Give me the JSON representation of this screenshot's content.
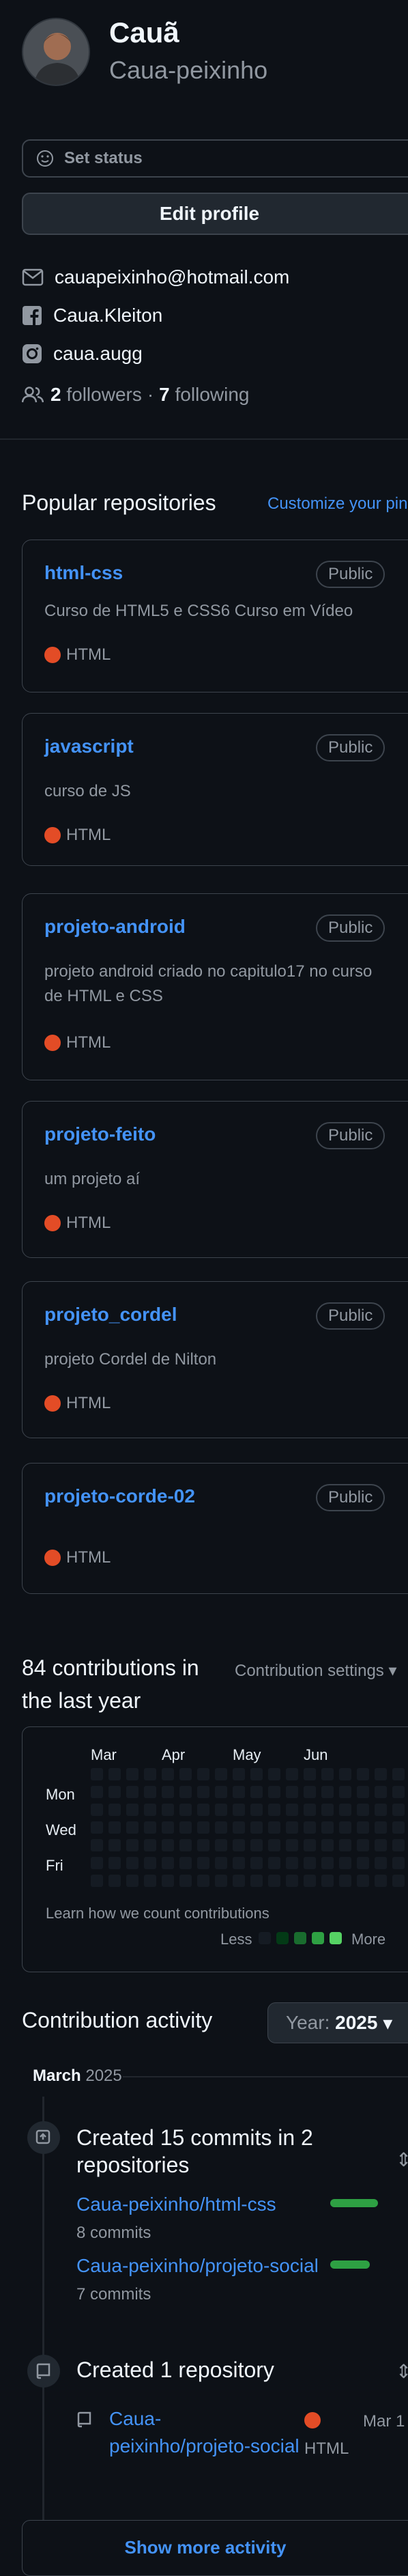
{
  "profile": {
    "name": "Cauã",
    "username": "Caua-peixinho",
    "status_label": "Set status",
    "edit_label": "Edit profile",
    "email": "cauapeixinho@hotmail.com",
    "facebook": "Caua.Kleiton",
    "instagram": "caua.augg",
    "followers_count": "2",
    "followers_label": "followers",
    "separator": "·",
    "following_count": "7",
    "following_label": "following"
  },
  "popular": {
    "title": "Popular repositories",
    "customize": "Customize your pins",
    "repos": [
      {
        "name": "html-css",
        "visibility": "Public",
        "description": "Curso de HTML5 e CSS6 Curso em Vídeo",
        "language": "HTML"
      },
      {
        "name": "javascript",
        "visibility": "Public",
        "description": "curso de JS",
        "language": "HTML"
      },
      {
        "name": "projeto-android",
        "visibility": "Public",
        "description": "projeto android criado no capitulo17 no curso de HTML e CSS",
        "language": "HTML"
      },
      {
        "name": "projeto-feito",
        "visibility": "Public",
        "description": "um projeto aí",
        "language": "HTML"
      },
      {
        "name": "projeto_cordel",
        "visibility": "Public",
        "description": "projeto Cordel de Nilton",
        "language": "HTML"
      },
      {
        "name": "projeto-corde-02",
        "visibility": "Public",
        "description": "",
        "language": "HTML"
      }
    ],
    "language_color": "#e34c26"
  },
  "contributions": {
    "title_line1": "84 contributions in",
    "title_line2": "the last year",
    "settings": "Contribution settings",
    "months": [
      "Mar",
      "Apr",
      "May",
      "Jun"
    ],
    "days": [
      "Mon",
      "Wed",
      "Fri"
    ],
    "learn": "Learn how we count contributions",
    "less": "Less",
    "more": "More",
    "legend_colors": [
      "#151b23",
      "#033a16",
      "#196c2e",
      "#2ea043",
      "#56d364"
    ]
  },
  "activity": {
    "title": "Contribution activity",
    "year_prefix": "Year:",
    "year": "2025",
    "month": "March",
    "month_year": "2025",
    "commits_title": "Created 15 commits in 2 repositories",
    "commit_repos": [
      {
        "name": "Caua-peixinho/html-css",
        "count": "8 commits"
      },
      {
        "name": "Caua-peixinho/projeto-social",
        "count": "7 commits"
      }
    ],
    "created_title": "Created 1 repository",
    "created_repo_line1": "Caua-",
    "created_repo_line2": "peixinho/projeto-social",
    "created_language": "HTML",
    "created_date": "Mar 1",
    "show_more": "Show more activity"
  }
}
